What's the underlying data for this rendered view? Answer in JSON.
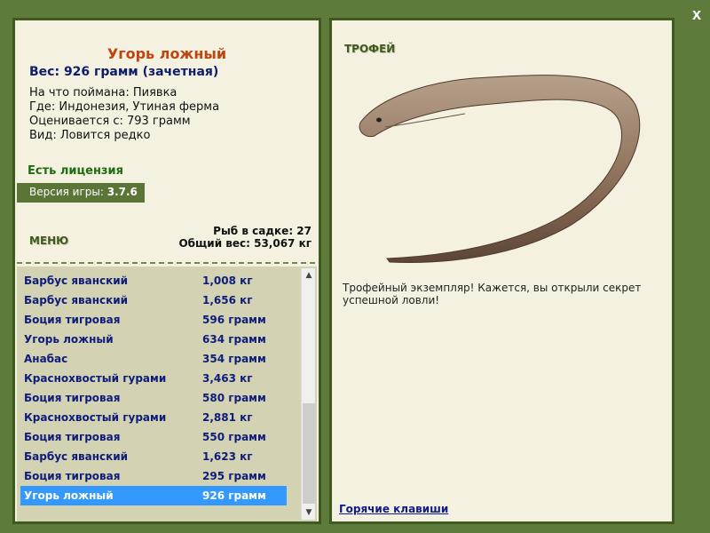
{
  "close_label": "x",
  "fish": {
    "title": "Угорь ложный",
    "weight_line": "Вес: 926 грамм (зачетная)",
    "details": [
      "На что поймана: Пиявка",
      "Где: Индонезия, Утиная ферма",
      "Оценивается с: 793 грамм",
      "Вид: Ловится редко"
    ]
  },
  "license": "Есть лицензия",
  "version": {
    "label": "Версия игры:",
    "value": "3.7.6"
  },
  "menu_label": "МЕНЮ",
  "stats": {
    "fish_in_cage": "Рыб в садке: 27",
    "total_weight": "Общий вес: 53,067 кг"
  },
  "catch_list": [
    {
      "name": "Барбус яванский",
      "weight": "1,008 кг"
    },
    {
      "name": "Барбус яванский",
      "weight": "1,656 кг"
    },
    {
      "name": "Боция тигровая",
      "weight": "596 грамм"
    },
    {
      "name": "Угорь ложный",
      "weight": "634 грамм"
    },
    {
      "name": "Анабас",
      "weight": "354 грамм"
    },
    {
      "name": "Краснохвостый гурами",
      "weight": "3,463 кг"
    },
    {
      "name": "Боция тигровая",
      "weight": "580 грамм"
    },
    {
      "name": "Краснохвостый гурами",
      "weight": "2,881 кг"
    },
    {
      "name": "Боция тигровая",
      "weight": "550 грамм"
    },
    {
      "name": "Барбус яванский",
      "weight": "1,623 кг"
    },
    {
      "name": "Боция тигровая",
      "weight": "295 грамм"
    },
    {
      "name": "Угорь ложный",
      "weight": "926 грамм"
    }
  ],
  "selected_index": 11,
  "trophy": {
    "label": "ТРОФЕЙ",
    "text": "Трофейный экземпляр! Кажется, вы открыли секрет успешной ловли!"
  },
  "hotkeys_label": "Горячие клавиши",
  "colors": {
    "frame": "#5f7b3b",
    "panel": "#f4f1e0",
    "list_bg": "#d3d3b4",
    "selection": "#3399ff",
    "title": "#c0440e",
    "list_text": "#0e1c7a"
  },
  "icons": {
    "close": "close-icon",
    "scroll_up": "chevron-up-icon",
    "scroll_down": "chevron-down-icon"
  }
}
